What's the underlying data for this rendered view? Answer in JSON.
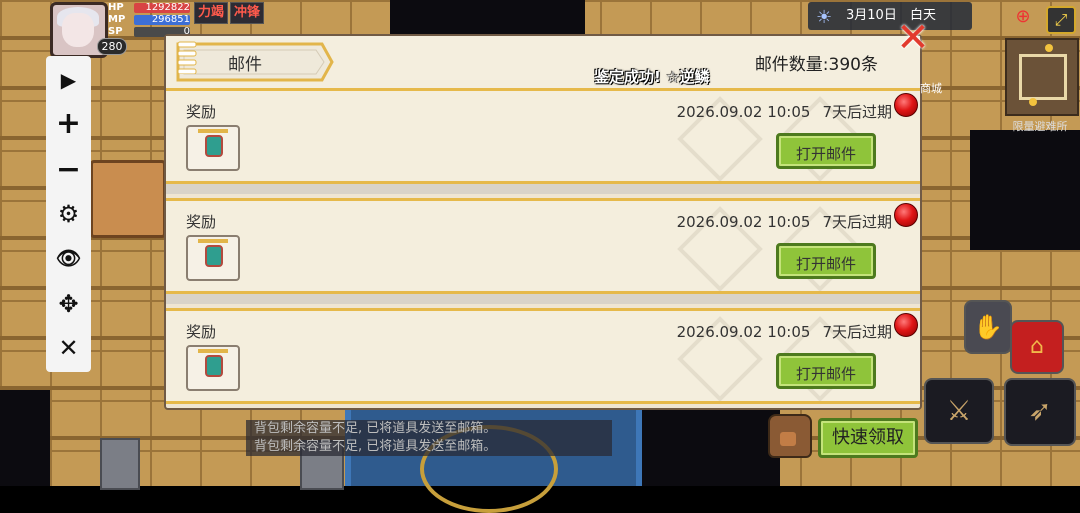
{
  "hud": {
    "stats": [
      {
        "label": "HP",
        "value": "1292822",
        "color": "#d84444"
      },
      {
        "label": "MP",
        "value": "296851",
        "color": "#3d6fd6"
      },
      {
        "label": "SP",
        "value": "0",
        "color": "#7a7a7a"
      }
    ],
    "level": "280",
    "tags": [
      "力竭",
      "冲锋"
    ],
    "date": "3月10日",
    "period": "白天",
    "map_name": "限量避难所",
    "city_label": "商城"
  },
  "toolbar": {
    "play": "▶",
    "plus": "+",
    "minus": "−",
    "settings": "⚙",
    "eye": "👁",
    "move": "✥",
    "close": "✕"
  },
  "mail_panel": {
    "title": "邮件",
    "count_text": "邮件数量:390条",
    "toast": "鉴定成功! ☆逆鳞",
    "close_symbol": "✕",
    "mails": [
      {
        "label": "奖励",
        "date": "2026.09.02 10:05",
        "expire": "7天后过期",
        "button": "打开邮件"
      },
      {
        "label": "奖励",
        "date": "2026.09.02 10:05",
        "expire": "7天后过期",
        "button": "打开邮件"
      },
      {
        "label": "奖励",
        "date": "2026.09.02 10:05",
        "expire": "7天后过期",
        "button": "打开邮件"
      }
    ],
    "quick_claim": "快速领取"
  },
  "system_messages": [
    "背包剩余容量不足, 已将道具发送至邮箱。",
    "背包剩余容量不足, 已将道具发送至邮箱。"
  ],
  "colors": {
    "accent_green": "#8fc43a",
    "close_red": "#e23a2e",
    "card_border": "#e6b94a"
  }
}
